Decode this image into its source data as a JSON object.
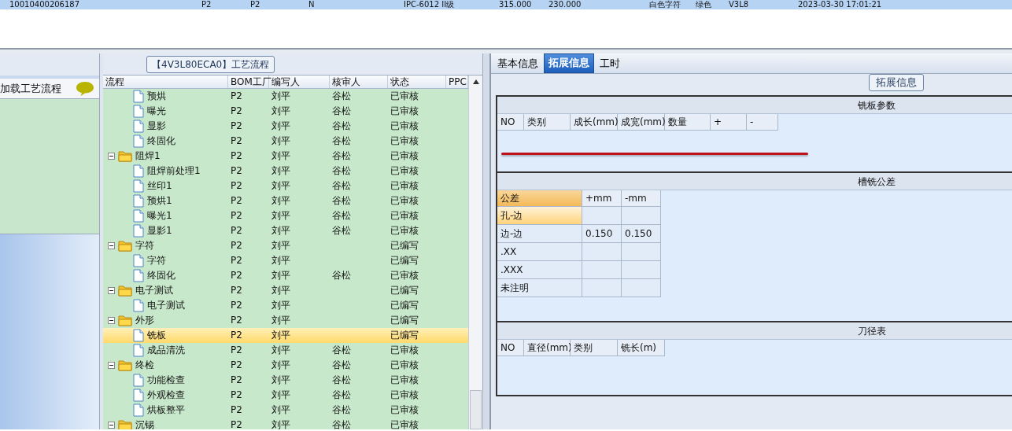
{
  "top_grid": {
    "row": {
      "selected": true,
      "cells": [
        "10010400206187",
        "P2",
        "P2",
        "N",
        "IPC-6012 II级",
        "315.000",
        "230.000",
        "白色字符",
        "绿色",
        "V3L8",
        "2023-03-30 17:01:21"
      ]
    }
  },
  "left_panel": {
    "action": "加载工艺流程"
  },
  "process": {
    "title": "【4V3L80ECA0】工艺流程",
    "columns": [
      "流程",
      "BOM工厂",
      "编写人",
      "核审人",
      "状态",
      "PPC"
    ],
    "rows": [
      {
        "children": [
          {
            "kind": "file",
            "name": "预烘",
            "bom": "P2",
            "writer": "刘平",
            "reviewer": "谷松",
            "status": "已审核",
            "selected": false
          },
          {
            "kind": "file",
            "name": "曝光",
            "bom": "P2",
            "writer": "刘平",
            "reviewer": "谷松",
            "status": "已审核",
            "selected": false
          },
          {
            "kind": "file",
            "name": "显影",
            "bom": "P2",
            "writer": "刘平",
            "reviewer": "谷松",
            "status": "已审核",
            "selected": false
          },
          {
            "kind": "file",
            "name": "终固化",
            "bom": "P2",
            "writer": "刘平",
            "reviewer": "谷松",
            "status": "已审核",
            "selected": false
          }
        ]
      },
      {
        "kind": "folder",
        "expanded": true,
        "name": "阻焊1",
        "bom": "P2",
        "writer": "刘平",
        "reviewer": "谷松",
        "status": "已审核",
        "selected": false,
        "children": [
          {
            "kind": "file",
            "name": "阻焊前处理1",
            "bom": "P2",
            "writer": "刘平",
            "reviewer": "谷松",
            "status": "已审核",
            "selected": false
          },
          {
            "kind": "file",
            "name": "丝印1",
            "bom": "P2",
            "writer": "刘平",
            "reviewer": "谷松",
            "status": "已审核",
            "selected": false
          },
          {
            "kind": "file",
            "name": "预烘1",
            "bom": "P2",
            "writer": "刘平",
            "reviewer": "谷松",
            "status": "已审核",
            "selected": false
          },
          {
            "kind": "file",
            "name": "曝光1",
            "bom": "P2",
            "writer": "刘平",
            "reviewer": "谷松",
            "status": "已审核",
            "selected": false
          },
          {
            "kind": "file",
            "name": "显影1",
            "bom": "P2",
            "writer": "刘平",
            "reviewer": "谷松",
            "status": "已审核",
            "selected": false
          }
        ]
      },
      {
        "kind": "folder",
        "expanded": true,
        "name": "字符",
        "bom": "P2",
        "writer": "刘平",
        "status": "已编写",
        "selected": false,
        "children": [
          {
            "kind": "file",
            "name": "字符",
            "bom": "P2",
            "writer": "刘平",
            "status": "已编写",
            "selected": false
          },
          {
            "kind": "file",
            "name": "终固化",
            "bom": "P2",
            "writer": "刘平",
            "reviewer": "谷松",
            "status": "已审核",
            "selected": false
          }
        ]
      },
      {
        "kind": "folder",
        "expanded": true,
        "name": "电子测试",
        "bom": "P2",
        "writer": "刘平",
        "status": "已编写",
        "selected": false,
        "children": [
          {
            "kind": "file",
            "name": "电子测试",
            "bom": "P2",
            "writer": "刘平",
            "status": "已编写",
            "selected": false
          }
        ]
      },
      {
        "kind": "folder",
        "expanded": true,
        "name": "外形",
        "bom": "P2",
        "writer": "刘平",
        "status": "已编写",
        "selected": false,
        "children": [
          {
            "kind": "file",
            "name": "铣板",
            "bom": "P2",
            "writer": "刘平",
            "status": "已编写",
            "selected": true
          },
          {
            "kind": "file",
            "name": "成品清洗",
            "bom": "P2",
            "writer": "刘平",
            "reviewer": "谷松",
            "status": "已审核",
            "selected": false
          }
        ]
      },
      {
        "kind": "folder",
        "expanded": true,
        "name": "终检",
        "bom": "P2",
        "writer": "刘平",
        "reviewer": "谷松",
        "status": "已审核",
        "selected": false,
        "children": [
          {
            "kind": "file",
            "name": "功能检查",
            "bom": "P2",
            "writer": "刘平",
            "reviewer": "谷松",
            "status": "已审核",
            "selected": false
          },
          {
            "kind": "file",
            "name": "外观检查",
            "bom": "P2",
            "writer": "刘平",
            "reviewer": "谷松",
            "status": "已审核",
            "selected": false
          },
          {
            "kind": "file",
            "name": "烘板整平",
            "bom": "P2",
            "writer": "刘平",
            "reviewer": "谷松",
            "status": "已审核",
            "selected": false
          }
        ]
      },
      {
        "kind": "folder",
        "expanded": true,
        "name": "沉锡",
        "bom": "P2",
        "writer": "刘平",
        "reviewer": "谷松",
        "status": "已审核",
        "selected": false
      }
    ]
  },
  "detail": {
    "tabs": [
      {
        "label": "基本信息",
        "selected": false
      },
      {
        "label": "拓展信息",
        "selected": true
      },
      {
        "label": "工时",
        "selected": false
      }
    ],
    "group_title": "拓展信息",
    "milling": {
      "title": "铣板参数",
      "columns": [
        "NO",
        "类别",
        "成长(mm)",
        "成宽(mm)",
        "数量",
        "+",
        "-"
      ]
    },
    "tolerance": {
      "title": "槽铣公差",
      "columns": [
        "公差",
        "+mm",
        "-mm"
      ],
      "rows": [
        {
          "cells": [
            "孔-边",
            "",
            ""
          ],
          "selected": true
        },
        {
          "cells": [
            "边-边",
            "0.150",
            "0.150"
          ],
          "selected": false
        },
        {
          "cells": [
            ".XX",
            "",
            ""
          ],
          "selected": false
        },
        {
          "cells": [
            ".XXX",
            "",
            ""
          ],
          "selected": false
        },
        {
          "cells": [
            "未注明",
            "",
            ""
          ],
          "selected": false
        }
      ]
    },
    "tools": {
      "title": "刀径表",
      "columns": [
        "NO",
        "直径(mm)",
        "类别",
        "铣长(m)"
      ]
    }
  }
}
